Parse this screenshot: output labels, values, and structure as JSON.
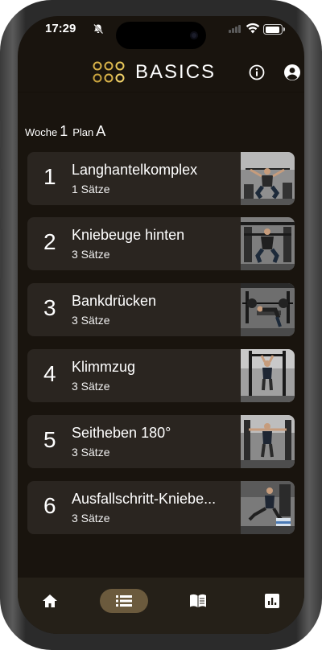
{
  "status_bar": {
    "time": "17:29",
    "icons": [
      "bell-slash-icon",
      "signal-icon",
      "wifi-icon",
      "battery-icon"
    ]
  },
  "app_bar": {
    "logo_text": "BASICS",
    "logo_icon": "dots-grid-logo",
    "actions": [
      "info-icon",
      "account-icon"
    ]
  },
  "plan": {
    "week_label": "Woche",
    "week_value": "1",
    "plan_label": "Plan",
    "plan_value": "A"
  },
  "exercises": [
    {
      "number": "1",
      "name": "Langhantelkomplex",
      "sets": "1 Sätze"
    },
    {
      "number": "2",
      "name": "Kniebeuge hinten",
      "sets": "3 Sätze"
    },
    {
      "number": "3",
      "name": "Bankdrücken",
      "sets": "3 Sätze"
    },
    {
      "number": "4",
      "name": "Klimmzug",
      "sets": "3 Sätze"
    },
    {
      "number": "5",
      "name": "Seitheben 180°",
      "sets": "3 Sätze"
    },
    {
      "number": "6",
      "name": "Ausfallschritt-Kniebe...",
      "sets": "3 Sätze"
    }
  ],
  "bottom_nav": {
    "items": [
      "home-icon",
      "list-icon",
      "book-icon",
      "chart-icon"
    ],
    "active_index": 1
  },
  "colors": {
    "background": "#19140e",
    "card": "#2a2520",
    "accent": "#d9b34a",
    "nav_active": "#6b5a3d",
    "bottom_bar": "#252018"
  }
}
